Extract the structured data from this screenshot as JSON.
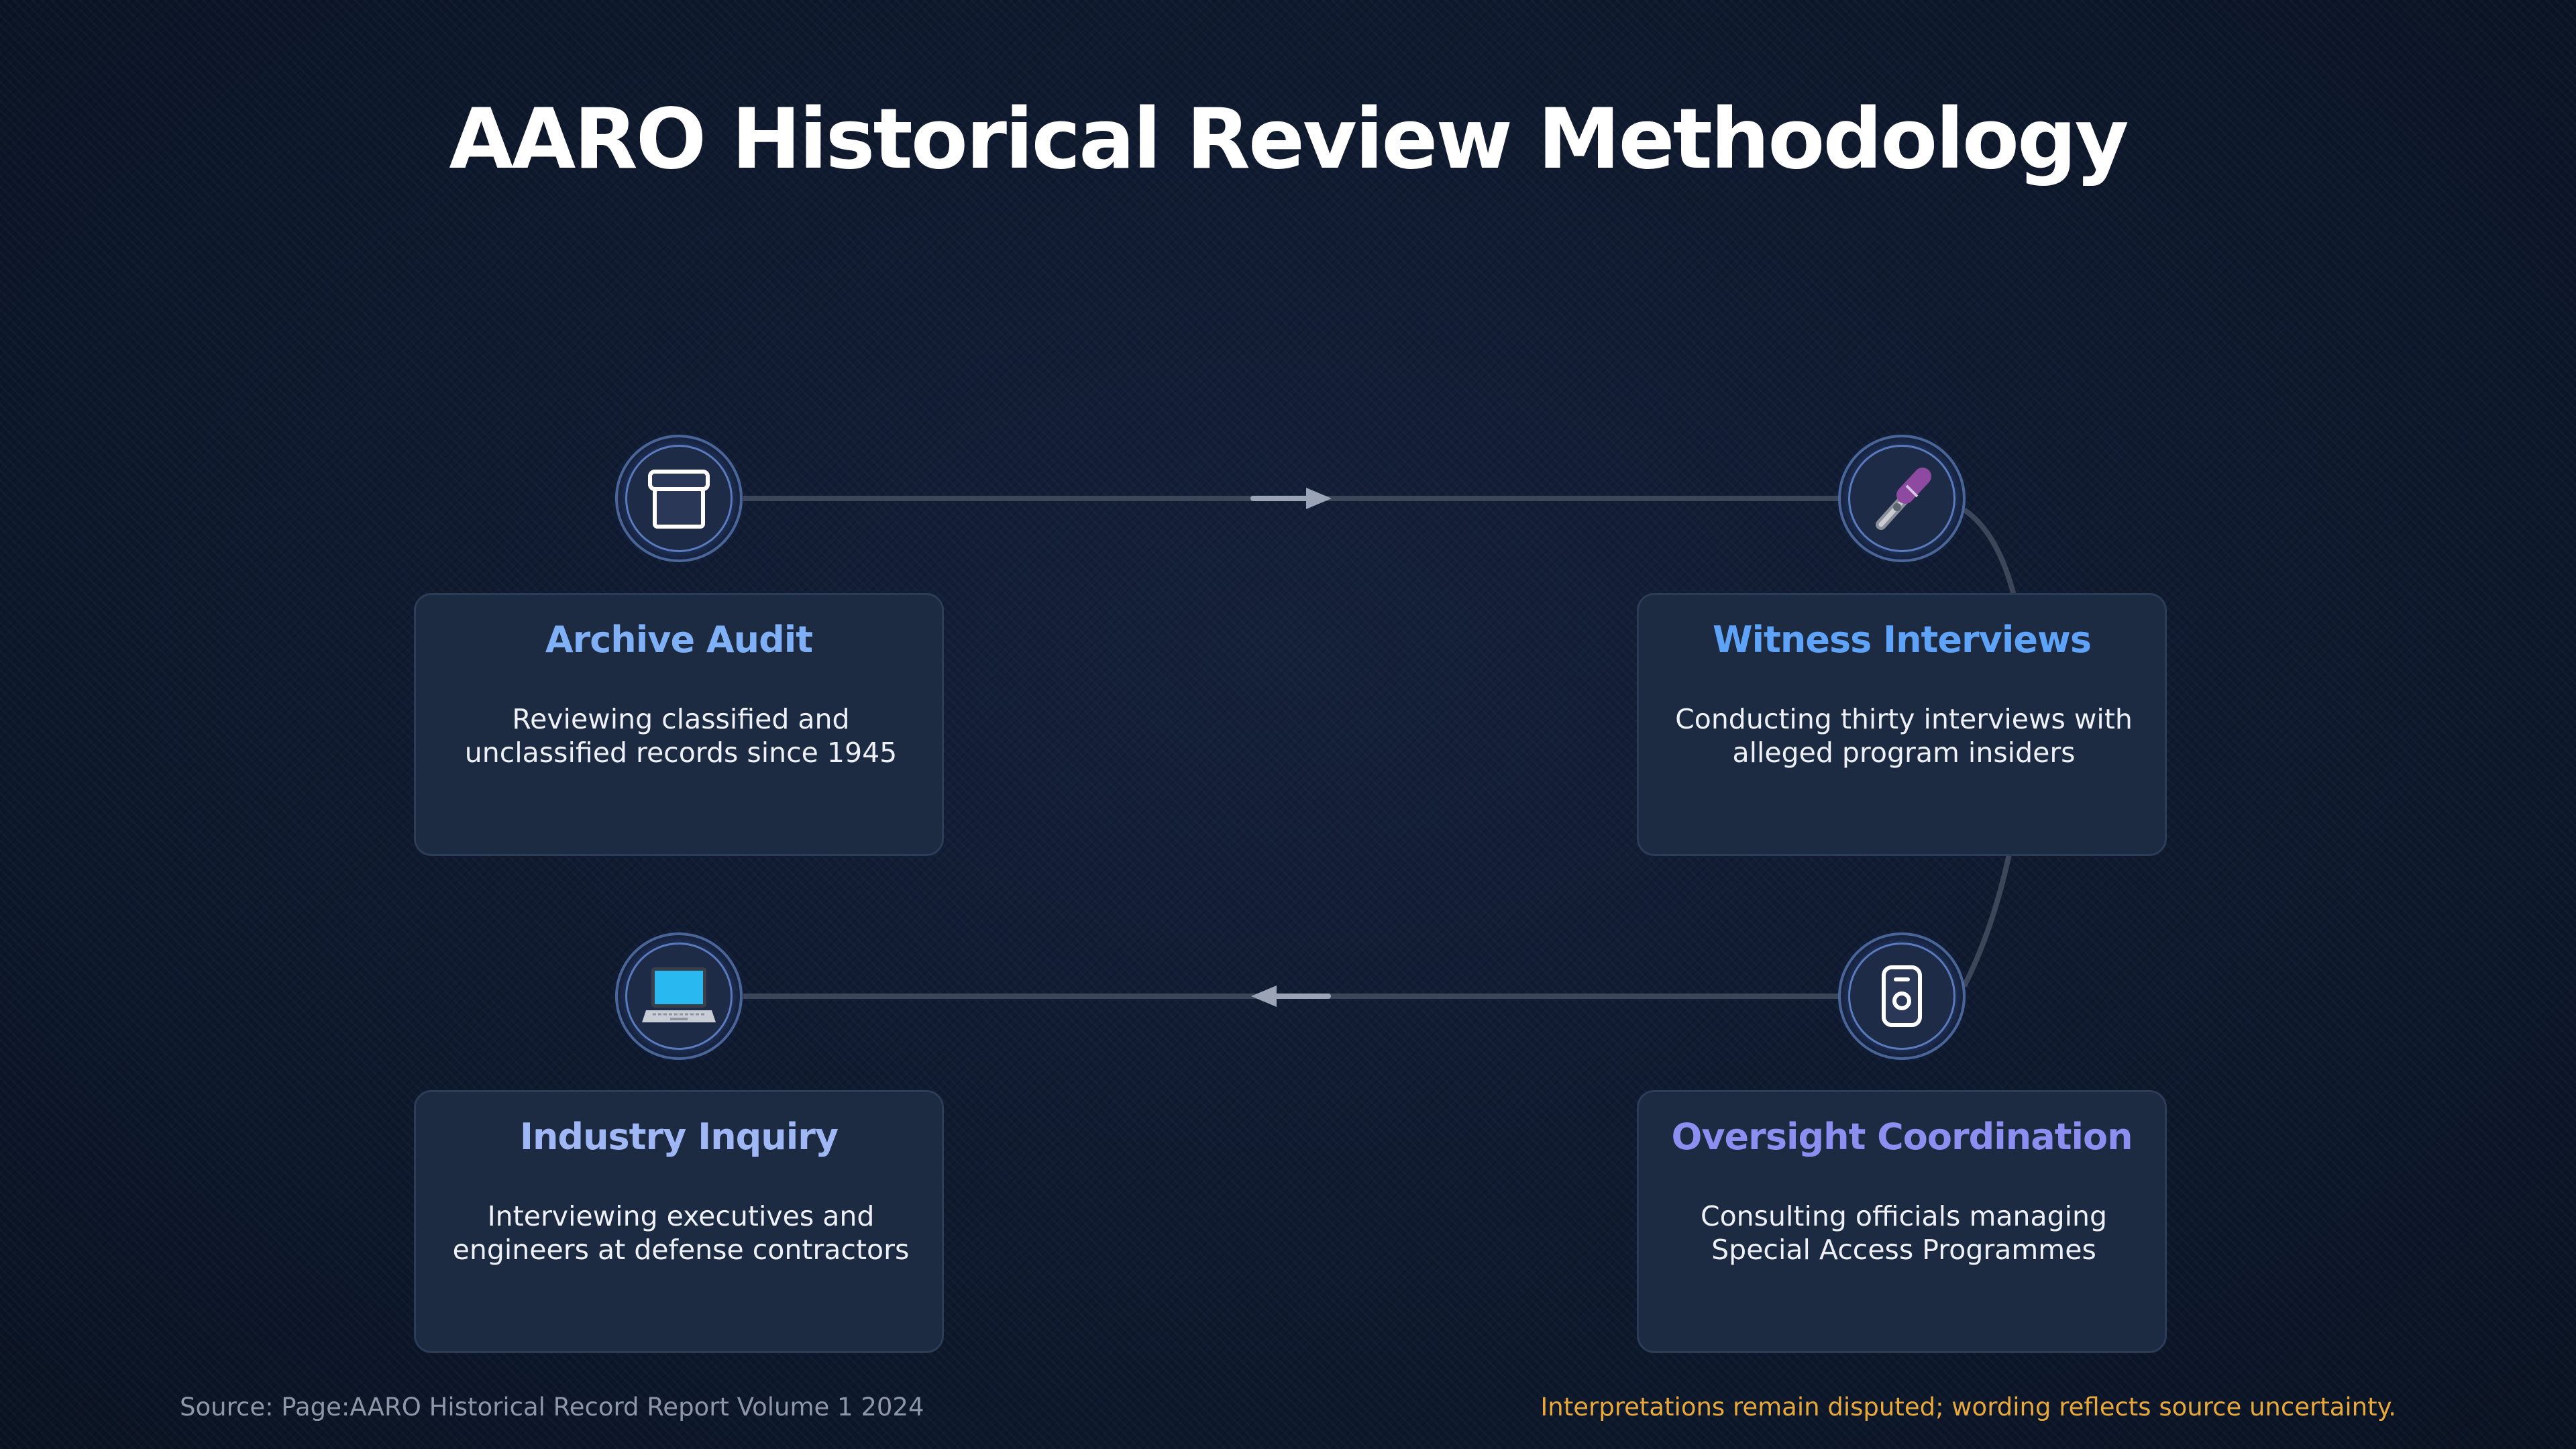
{
  "title": "AARO Historical Review Methodology",
  "steps": [
    {
      "title": "Archive Audit",
      "description": "Reviewing classified and unclassified records since 1945",
      "icon": "archive-box-icon",
      "title_color": "#7fb0f5"
    },
    {
      "title": "Witness Interviews",
      "description": "Conducting thirty interviews with alleged program insiders",
      "icon": "microphone-icon",
      "title_color": "#5ea3f7"
    },
    {
      "title": "Oversight Coordination",
      "description": "Consulting officials managing Special Access Programmes",
      "icon": "id-badge-icon",
      "title_color": "#8c8ff0"
    },
    {
      "title": "Industry Inquiry",
      "description": "Interviewing executives and engineers at defense contractors",
      "icon": "laptop-icon",
      "title_color": "#9fb8f5"
    }
  ],
  "source": "Source: Page:AARO Historical Record Report Volume 1 2024",
  "disclaimer": "Interpretations remain disputed; wording reflects source uncertainty.",
  "colors": {
    "background": "#0f1a2e",
    "card": "#1c2a42",
    "connector": "#3b4659",
    "arrow": "#9aa4b6",
    "disclaimer": "#e8a93a"
  }
}
